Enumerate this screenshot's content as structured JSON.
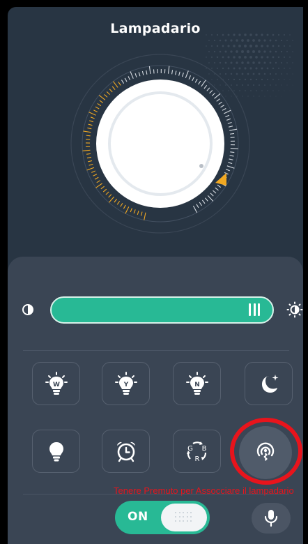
{
  "header": {
    "title": "Lampadario"
  },
  "brightness": {
    "min_icon": "brightness-low-icon",
    "max_icon": "brightness-high-icon",
    "level": 1.0
  },
  "dial": {
    "accent": "#f2a922"
  },
  "presets": {
    "row1": [
      {
        "name": "preset-warm",
        "letter": "W"
      },
      {
        "name": "preset-yellow",
        "letter": "Y"
      },
      {
        "name": "preset-neutral",
        "letter": "N"
      },
      {
        "name": "preset-night",
        "icon": "moon-icon"
      }
    ],
    "row2": [
      {
        "name": "bulb",
        "icon": "bulb-icon"
      },
      {
        "name": "alarm",
        "icon": "alarm-clock-icon"
      },
      {
        "name": "rgb-cycle",
        "letters": [
          "G",
          "B",
          "R"
        ]
      },
      {
        "name": "bluetooth-pair",
        "icon": "bluetooth-signal-icon"
      }
    ]
  },
  "hint": {
    "text": "Tenere Premuto per Assocciare il lampadario"
  },
  "power": {
    "label": "ON"
  },
  "colors": {
    "accent": "#28b995",
    "background": "#283543",
    "panel": "#3a4554",
    "warning": "#e8141c"
  }
}
